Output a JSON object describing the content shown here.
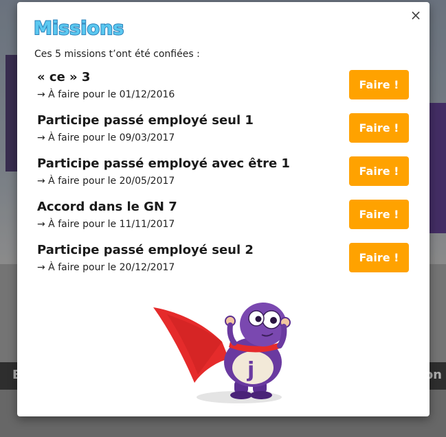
{
  "modal": {
    "title": "Missions",
    "intro": "Ces 5 missions t’ont été confiées :",
    "close_glyph": "×"
  },
  "missions": [
    {
      "title": "« ce » 3",
      "due": "→ À faire pour le 01/12/2016",
      "button": "Faire !"
    },
    {
      "title": "Participe passé employé seul 1",
      "due": "→ À faire pour le 09/03/2017",
      "button": "Faire !"
    },
    {
      "title": "Participe passé employé avec être 1",
      "due": "→ À faire pour le 20/05/2017",
      "button": "Faire !"
    },
    {
      "title": "Accord dans le GN 7",
      "due": "→ À faire pour le 11/11/2017",
      "button": "Faire !"
    },
    {
      "title": "Participe passé employé seul 2",
      "due": "→ À faire pour le 20/12/2017",
      "button": "Faire !"
    }
  ],
  "background": {
    "left_text": "E",
    "right_text": "on"
  },
  "colors": {
    "button": "#ffa200",
    "title_fill": "#5bc8f0",
    "mascot_body": "#6a3aa0",
    "cape": "#e52b2b"
  },
  "icons": [
    "close-icon",
    "mascot-illustration"
  ]
}
